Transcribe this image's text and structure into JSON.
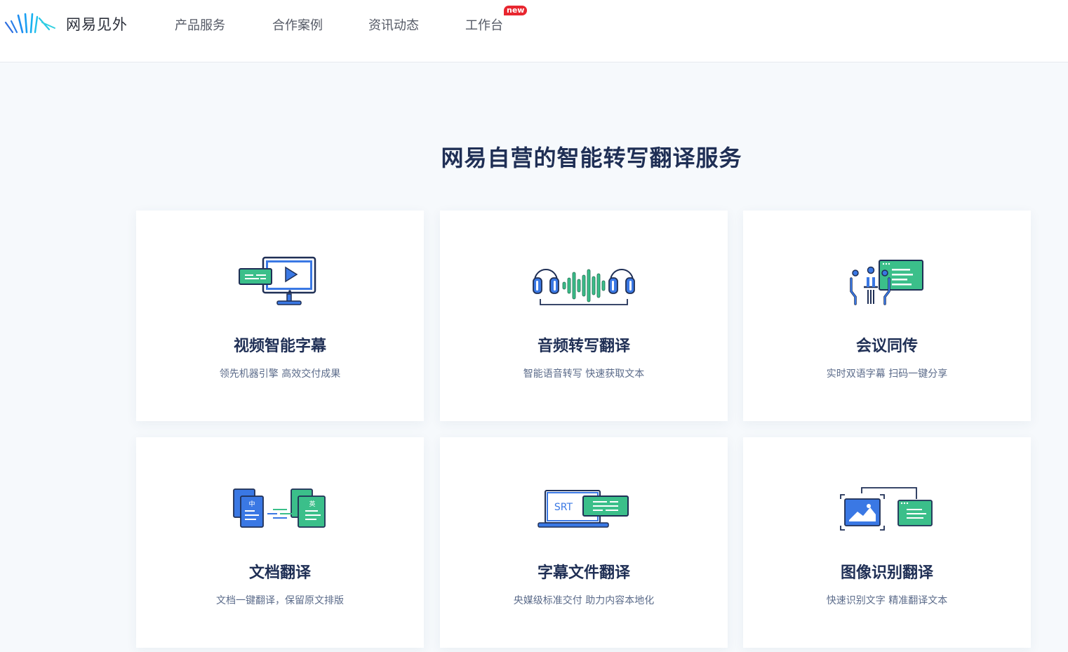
{
  "brand": {
    "name": "网易见外",
    "logo_icon": "wave-lines-logo"
  },
  "nav": [
    {
      "label": "产品服务"
    },
    {
      "label": "合作案例"
    },
    {
      "label": "资讯动态"
    },
    {
      "label": "工作台",
      "badge": "new"
    }
  ],
  "main": {
    "title": "网易自营的智能转写翻译服务",
    "cards": [
      {
        "title": "视频智能字幕",
        "subtitle": "领先机器引擎 高效交付成果",
        "icon": "video-monitor-icon"
      },
      {
        "title": "音频转写翻译",
        "subtitle": "智能语音转写 快速获取文本",
        "icon": "headphones-waveform-icon"
      },
      {
        "title": "会议同传",
        "subtitle": "实时双语字幕 扫码一键分享",
        "icon": "meeting-people-icon"
      },
      {
        "title": "文档翻译",
        "subtitle": "文档一键翻译，保留原文排版",
        "icon": "document-translate-icon",
        "icon_labels": [
          "中",
          "英"
        ]
      },
      {
        "title": "字幕文件翻译",
        "subtitle": "央媒级标准交付 助力内容本地化",
        "icon": "srt-laptop-icon",
        "icon_label": "SRT"
      },
      {
        "title": "图像识别翻译",
        "subtitle": "快速识别文字 精准翻译文本",
        "icon": "image-recognition-icon"
      }
    ]
  },
  "colors": {
    "primary_blue": "#3a78e4",
    "accent_green": "#3bbf8a",
    "dark_navy": "#1f2f55",
    "badge_red": "#e8262f"
  }
}
